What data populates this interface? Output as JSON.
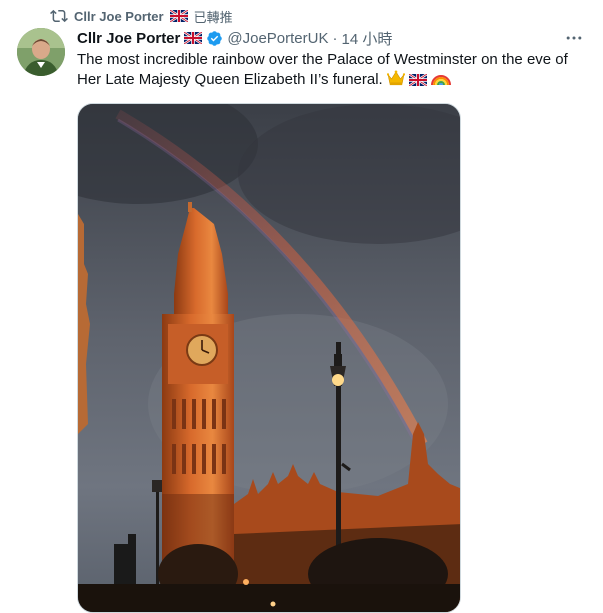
{
  "retweet": {
    "label": "Cllr Joe Porter",
    "suffix": "已轉推",
    "flag_icon": "uk-flag-icon"
  },
  "tweet": {
    "author_name": "Cllr Joe Porter",
    "handle": "@JoePorterUK",
    "separator": "·",
    "time": "14 小時",
    "verified": true,
    "text": "The most incredible rainbow over the Palace of Westminster on the eve of Her Late Majesty Queen Elizabeth II’s funeral.",
    "emojis": [
      "crown-emoji",
      "uk-flag-emoji",
      "rainbow-emoji"
    ],
    "more_icon": "more-icon"
  },
  "media": {
    "description_icon": "photo"
  },
  "colors": {
    "text_primary": "#0f1419",
    "text_secondary": "#536471",
    "verified_blue": "#1d9bf0"
  }
}
